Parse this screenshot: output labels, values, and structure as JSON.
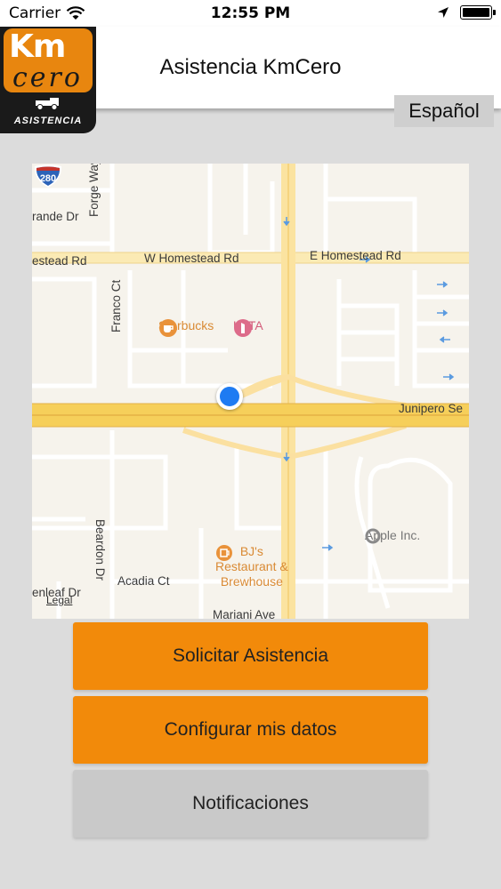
{
  "status_bar": {
    "carrier": "Carrier",
    "time": "12:55 PM"
  },
  "header": {
    "title": "Asistencia KmCero",
    "language_button": "Español"
  },
  "logo": {
    "km": "Km",
    "cero": "cero",
    "sub": "ASISTENCIA"
  },
  "map": {
    "streets": {
      "w_homestead": "W Homestead Rd",
      "e_homestead": "E Homestead Rd",
      "homestead_left": "estead Rd",
      "grande": "rande Dr",
      "forge": "Forge Way",
      "franco": "Franco Ct",
      "beardon": "Beardon Dr",
      "acadia": "Acadia Ct",
      "greenleaf": "enleaf Dr",
      "mariani": "Mariani Ave",
      "junipero": "Junipero Se"
    },
    "highway_shield": "280",
    "pois": {
      "starbucks": "Starbucks",
      "ulta": "ULTA",
      "bjs_line1": "BJ's",
      "bjs_line2": "Restaurant &",
      "bjs_line3": "Brewhouse",
      "apple": "Apple Inc."
    },
    "legal": "Legal"
  },
  "buttons": {
    "request": "Solicitar Asistencia",
    "configure": "Configurar mis datos",
    "notifications": "Notificaciones"
  },
  "colors": {
    "accent_orange": "#f28a0a",
    "button_gray": "#c9c9c9",
    "background": "#dcdcdc",
    "user_location": "#1e7bf2"
  }
}
